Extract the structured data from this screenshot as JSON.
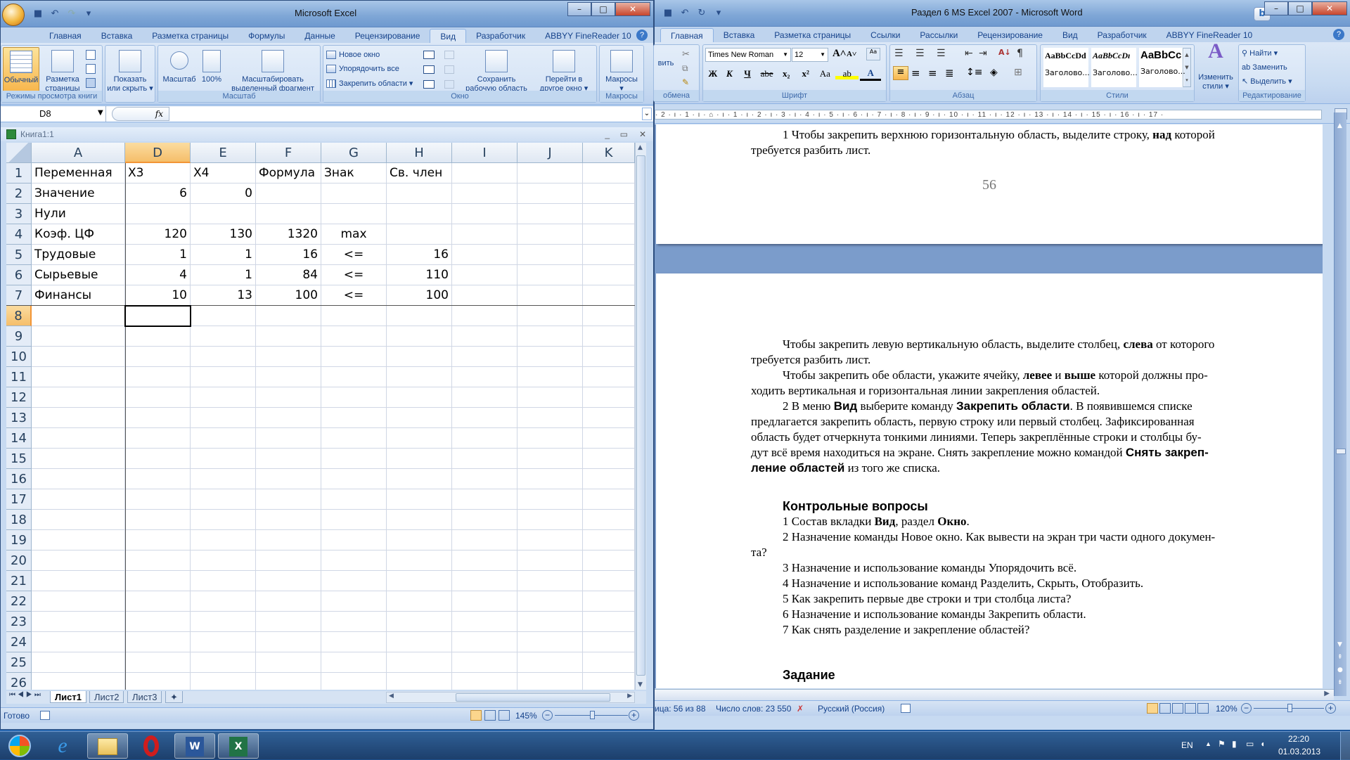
{
  "excel": {
    "title": "Microsoft Excel",
    "tabs": [
      "Главная",
      "Вставка",
      "Разметка страницы",
      "Формулы",
      "Данные",
      "Рецензирование",
      "Вид",
      "Разработчик",
      "ABBYY FineReader 10"
    ],
    "active_tab": "Вид",
    "ribbon": {
      "views_group": {
        "label": "Режимы просмотра книги",
        "normal": "Обычный",
        "page_layout_1": "Разметка",
        "page_layout_2": "страницы"
      },
      "show_hide": {
        "line1": "Показать",
        "line2": "или скрыть ▾"
      },
      "zoom_group": {
        "label": "Масштаб",
        "zoom": "Масштаб",
        "zoom100": "100%",
        "zoom_sel_1": "Масштабировать",
        "zoom_sel_2": "выделенный фрагмент"
      },
      "window_group": {
        "label": "Окно",
        "new_window": "Новое окно",
        "arrange_all": "Упорядочить все",
        "freeze_panes": "Закрепить области ▾",
        "save_ws_1": "Сохранить",
        "save_ws_2": "рабочую область",
        "switch_1": "Перейти в",
        "switch_2": "другое окно ▾"
      },
      "macros_group": {
        "label": "Макросы",
        "macros": "Макросы",
        "macros_arrow": "▾"
      }
    },
    "name_box": "D8",
    "fx_label": "fx",
    "formula_value": "",
    "workbook_title": "Книга1:1",
    "columns": [
      "A",
      "D",
      "E",
      "F",
      "G",
      "H",
      "I",
      "J",
      "K"
    ],
    "selected_column": "D",
    "selected_row": "8",
    "rows": [
      {
        "n": "1",
        "cells": [
          "Переменная",
          "X3",
          "X4",
          "Формула",
          "Знак",
          "Св. член",
          "",
          "",
          ""
        ]
      },
      {
        "n": "2",
        "cells": [
          "Значение",
          "6",
          "0",
          "",
          "",
          "",
          "",
          "",
          ""
        ]
      },
      {
        "n": "3",
        "cells": [
          "Нули",
          "",
          "",
          "",
          "",
          "",
          "",
          "",
          ""
        ]
      },
      {
        "n": "4",
        "cells": [
          "Коэф. ЦФ",
          "120",
          "130",
          "1320",
          "max",
          "",
          "",
          "",
          ""
        ]
      },
      {
        "n": "5",
        "cells": [
          "Трудовые",
          "1",
          "1",
          "16",
          "<=",
          "16",
          "",
          "",
          ""
        ]
      },
      {
        "n": "6",
        "cells": [
          "Сырьевые",
          "4",
          "1",
          "84",
          "<=",
          "110",
          "",
          "",
          ""
        ]
      },
      {
        "n": "7",
        "cells": [
          "Финансы",
          "10",
          "13",
          "100",
          "<=",
          "100",
          "",
          "",
          ""
        ]
      },
      {
        "n": "8",
        "cells": [
          "",
          "",
          "",
          "",
          "",
          "",
          "",
          "",
          ""
        ]
      },
      {
        "n": "9",
        "cells": []
      },
      {
        "n": "10",
        "cells": []
      },
      {
        "n": "11",
        "cells": []
      },
      {
        "n": "12",
        "cells": []
      },
      {
        "n": "13",
        "cells": []
      },
      {
        "n": "14",
        "cells": []
      },
      {
        "n": "15",
        "cells": []
      },
      {
        "n": "16",
        "cells": []
      },
      {
        "n": "17",
        "cells": []
      },
      {
        "n": "18",
        "cells": []
      },
      {
        "n": "19",
        "cells": []
      },
      {
        "n": "20",
        "cells": []
      },
      {
        "n": "21",
        "cells": []
      },
      {
        "n": "22",
        "cells": []
      },
      {
        "n": "23",
        "cells": []
      },
      {
        "n": "24",
        "cells": []
      },
      {
        "n": "25",
        "cells": []
      },
      {
        "n": "26",
        "cells": []
      }
    ],
    "sheet_tabs": [
      "Лист1",
      "Лист2",
      "Лист3"
    ],
    "active_sheet": "Лист1",
    "status": "Готово",
    "zoom_level": "145%"
  },
  "word": {
    "title": "Раздел 6 MS Excel 2007 - Microsoft Word",
    "tabs": [
      "Главная",
      "Вставка",
      "Разметка страницы",
      "Ссылки",
      "Рассылки",
      "Рецензирование",
      "Вид",
      "Разработчик",
      "ABBYY FineReader 10"
    ],
    "active_tab": "Главная",
    "ribbon": {
      "clipboard": {
        "label": "обмена",
        "paste": "вить"
      },
      "font": {
        "label": "Шрифт",
        "font_name": "Times New Roman",
        "font_size": "12",
        "bold": "Ж",
        "italic": "К",
        "underline": "Ч",
        "strike": "abe",
        "sub": "x₂",
        "sup": "x²",
        "case": "Aa"
      },
      "paragraph": {
        "label": "Абзац"
      },
      "styles": {
        "label": "Стили",
        "items": [
          {
            "preview": "AaBbCcDd",
            "name": "Заголово..."
          },
          {
            "preview": "AaBbCcDı",
            "name": "Заголово..."
          },
          {
            "preview": "AaBbCc",
            "name": "Заголово..."
          }
        ],
        "change": "Изменить",
        "change2": "стили ▾"
      },
      "editing": {
        "label": "Редактирование",
        "find": "Найти ▾",
        "replace": "Заменить",
        "select": "Выделить ▾"
      }
    },
    "ruler": "· 2 · ı · 1 · ı · ⌂ · ı · 1 · ı · 2 · ı · 3 · ı · 4 · ı · 5 · ı · 6 · ı · 7 · ı · 8 · ı · 9 · ı · 10 · ı · 11 · ı · 12 · ı · 13 · ı · 14 · ı · 15 · ı · 16 · ı · 17 ·",
    "page1": {
      "line1": "1 Чтобы закрепить верхнюю горизонтальную область, выделите строку, ",
      "line1_bold": "над",
      "line1_end": " которой",
      "line2": "требуется разбить лист.",
      "page_number": "56"
    },
    "page2": {
      "p1a": "Чтобы закрепить левую вертикальную область, выделите столбец, ",
      "p1b": "слева",
      "p1c": " от которого",
      "p1d": "требуется разбить лист.",
      "p2a": "Чтобы закрепить обе области, укажите ячейку, ",
      "p2b": "левее",
      "p2c": " и ",
      "p2d": "выше",
      "p2e": " которой должны про-",
      "p2f": "ходить вертикальная и горизонтальная линии закрепления областей.",
      "p3a": "2 В меню ",
      "p3b": "Вид",
      "p3c": " выберите команду ",
      "p3d": "Закрепить области",
      "p3e": ". В появившемся списке",
      "p3f": "предлагается закрепить область, первую строку или первый столбец. Зафиксированная",
      "p3g": "область будет отчеркнута тонкими линиями. Теперь закреплённые строки и столбцы бу-",
      "p3h": "дут всё время находиться на экране. Снять закрепление можно командой ",
      "p3i": "Снять закреп-",
      "p3j": "ление областей",
      "p3k": " из того же списка.",
      "questions_heading": "Контрольные вопросы",
      "q1a": "1 Состав вкладки ",
      "q1b": "Вид",
      "q1c": ", раздел ",
      "q1d": "Окно",
      "q1e": ".",
      "q2": "2 Назначение команды Новое окно. Как вывести  на экран три части одного докумен-",
      "q2b": "та?",
      "q3": "3 Назначение и использование команды Упорядочить всё.",
      "q4": "4 Назначение и использование команд Разделить, Скрыть, Отобразить.",
      "q5": "5 Как закрепить первые две строки и три столбца листа?",
      "q6": "6 Назначение и использование команды Закрепить области.",
      "q7": "7 Как снять разделение и закрепление областей?",
      "task_heading": "Задание"
    },
    "status": {
      "page": "ица: 56 из 88",
      "words": "Число слов: 23 550",
      "language": "Русский (Россия)",
      "zoom_level": "120%"
    }
  },
  "taskbar": {
    "apps": [
      "start",
      "internet-explorer",
      "explorer",
      "opera",
      "word",
      "excel"
    ],
    "lang": "EN",
    "time": "22:20",
    "date": "01.03.2013"
  }
}
